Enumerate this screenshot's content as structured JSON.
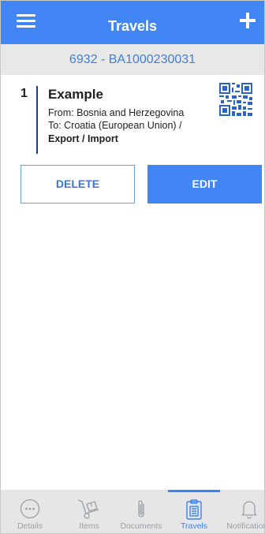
{
  "appbar": {
    "title": "Travels",
    "menu_icon": "hamburger-menu-icon",
    "add_icon": "plus-icon"
  },
  "subheader": {
    "text": "6932 - BA1000230031"
  },
  "travel": {
    "index": "1",
    "name": "Example",
    "from": "From: Bosnia and Herzegovina",
    "to": "To: Croatia (European Union) /",
    "type": "Export / Import",
    "qr_icon": "qr-code-icon"
  },
  "actions": {
    "delete": "DELETE",
    "edit": "EDIT"
  },
  "nav": {
    "items": [
      {
        "label": "Details",
        "icon": "ellipsis-icon",
        "active": false
      },
      {
        "label": "Items",
        "icon": "hand-truck-icon",
        "active": false
      },
      {
        "label": "Documents",
        "icon": "paperclip-icon",
        "active": false
      },
      {
        "label": "Travels",
        "icon": "clipboard-icon",
        "active": true
      },
      {
        "label": "Notifications",
        "icon": "bell-icon",
        "active": false
      }
    ]
  },
  "colors": {
    "primary": "#4285f4",
    "subheader_bg": "#e8e8e8",
    "subheader_text": "#3e7fd8",
    "nav_bg": "#e6e6e6",
    "nav_inactive": "#9aa0a6",
    "nav_active": "#3b82f6",
    "card_bar": "#1e3a8a"
  }
}
